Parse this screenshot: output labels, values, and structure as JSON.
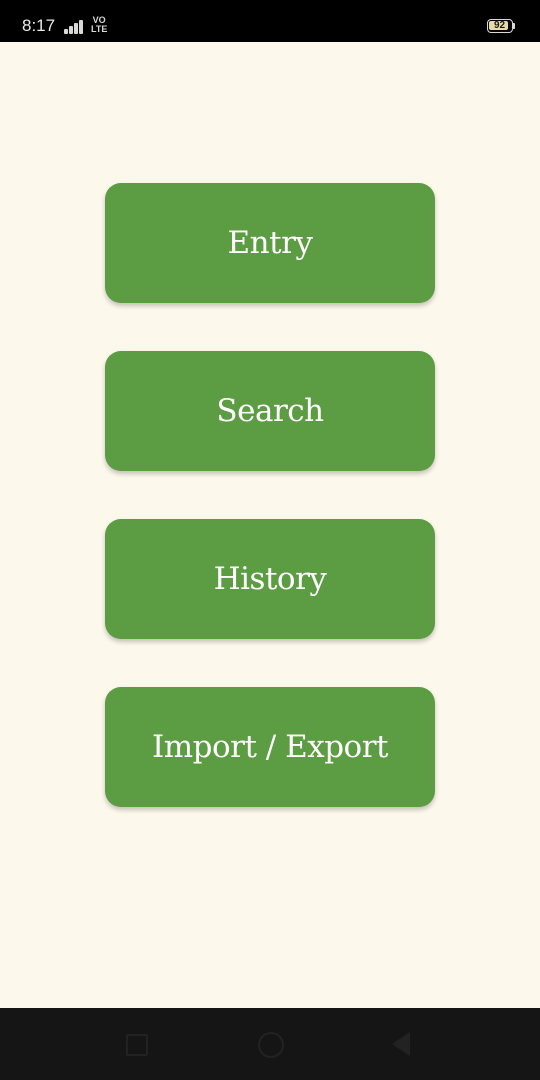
{
  "status_bar": {
    "time": "8:17",
    "network_line1": "VO",
    "network_line2": "LTE",
    "battery_level": "92",
    "icons": [
      "signal-icon",
      "battery-icon"
    ]
  },
  "menu": {
    "buttons": [
      {
        "label": "Entry"
      },
      {
        "label": "Search"
      },
      {
        "label": "History"
      },
      {
        "label": "Import / Export"
      }
    ]
  },
  "nav_bar": {
    "icons": [
      "recent-apps-icon",
      "home-icon",
      "back-icon"
    ]
  },
  "colors": {
    "background": "#fdf8ec",
    "button": "#5c9c43",
    "button_text": "#ffffff",
    "status_bar": "#000000",
    "nav_bar": "#151515"
  }
}
